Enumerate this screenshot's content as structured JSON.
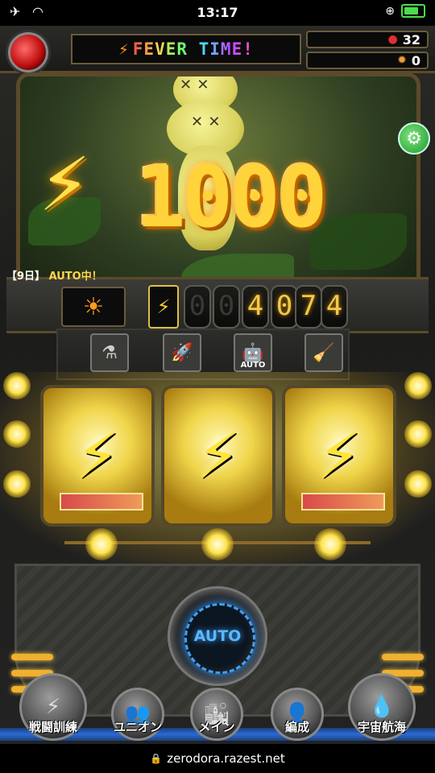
{
  "status_bar": {
    "time": "13:17",
    "airplane_icon": "✈",
    "wifi_icon": "wifi-icon",
    "battery_icon": "battery-charging-icon"
  },
  "header": {
    "fever_bolt": "⚡",
    "fever_text": "FEVER TIME!",
    "gem_count": "32",
    "bomb_count": "0"
  },
  "scene": {
    "big_bolt": "⚡",
    "big_number": "1000",
    "settings_icon": "⚙"
  },
  "status": {
    "day": "【9日】",
    "auto_text": "AUTO中！"
  },
  "counter": {
    "bolt": "⚡",
    "digits": [
      "0",
      "0",
      "4",
      "0",
      "7",
      "4"
    ],
    "sun_icon": "☀"
  },
  "items": [
    {
      "name": "item-canister",
      "icon": "⚗",
      "label": ""
    },
    {
      "name": "item-rocket",
      "icon": "🚀",
      "label": ""
    },
    {
      "name": "item-auto-robot",
      "icon": "🤖",
      "label": "AUTO"
    },
    {
      "name": "item-vacuum",
      "icon": "🧹",
      "label": ""
    }
  ],
  "reels": [
    "⚡",
    "⚡",
    "⚡"
  ],
  "auto_button": {
    "label": "AUTO"
  },
  "nav": [
    {
      "label": "戦闘訓練",
      "icon": "⚡"
    },
    {
      "label": "ユニオン",
      "icon": "👥"
    },
    {
      "label": "メイン",
      "icon": "🏙"
    },
    {
      "label": "編成",
      "icon": "👤"
    },
    {
      "label": "宇宙航海",
      "icon": "💧"
    }
  ],
  "url": {
    "text": "zerodora.razest.net",
    "lock_icon": "🔒"
  },
  "colors": {
    "accent": "#ffd43a",
    "auto_blue": "#3fa0ff",
    "frame": "#5c4a2a"
  }
}
